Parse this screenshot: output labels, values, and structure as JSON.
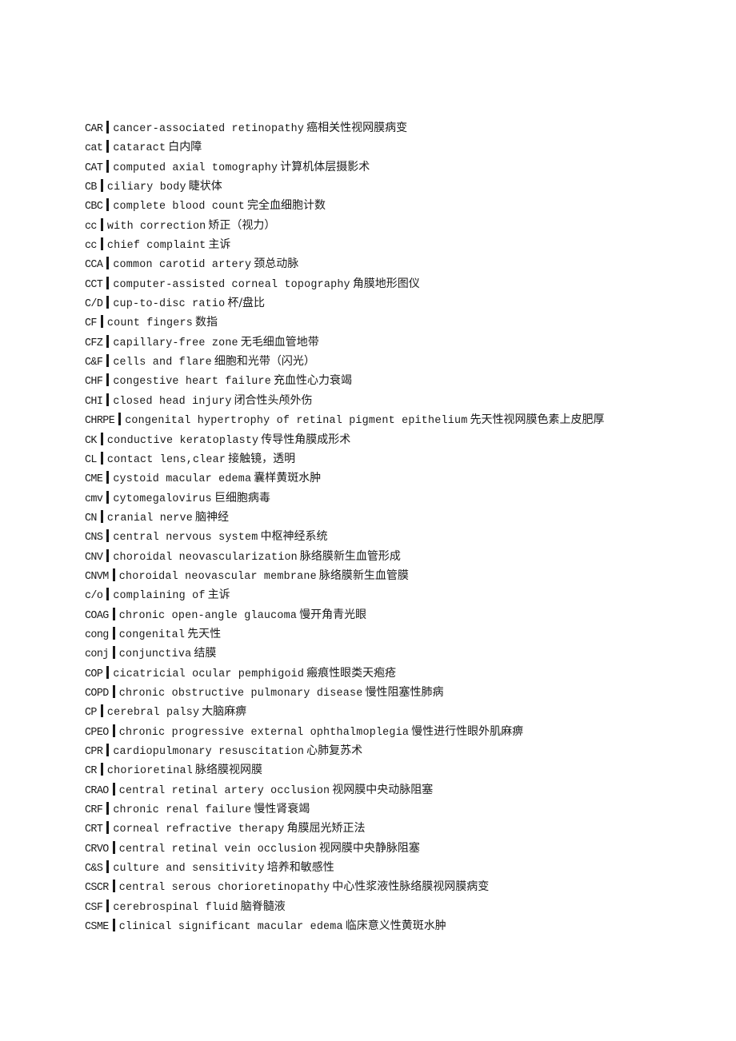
{
  "document": {
    "entries": [
      {
        "abbr": "CAR",
        "term": "cancer-associated retinopathy",
        "zh": "癌相关性视网膜病变"
      },
      {
        "abbr": "cat",
        "term": "cataract",
        "zh": "白内障"
      },
      {
        "abbr": "CAT",
        "term": "computed axial tomography",
        "zh": "计算机体层摄影术"
      },
      {
        "abbr": "CB",
        "term": "ciliary body",
        "zh": "睫状体"
      },
      {
        "abbr": "CBC",
        "term": "complete blood count",
        "zh": "完全血细胞计数"
      },
      {
        "abbr": "cc",
        "term": "with correction",
        "zh": "矫正（视力）"
      },
      {
        "abbr": "cc",
        "term": "chief complaint",
        "zh": "主诉"
      },
      {
        "abbr": "CCA",
        "term": "common carotid artery",
        "zh": "颈总动脉"
      },
      {
        "abbr": "CCT",
        "term": "computer-assisted corneal topography",
        "zh": "角膜地形图仪"
      },
      {
        "abbr": "C/D",
        "term": "cup-to-disc ratio",
        "zh": "杯/盘比"
      },
      {
        "abbr": "CF",
        "term": "count fingers",
        "zh": "数指"
      },
      {
        "abbr": "CFZ",
        "term": "capillary-free zone",
        "zh": "无毛细血管地带"
      },
      {
        "abbr": "C&F",
        "term": "cells and flare",
        "zh": "细胞和光带（闪光）"
      },
      {
        "abbr": "CHF",
        "term": "congestive heart failure",
        "zh": "充血性心力衰竭"
      },
      {
        "abbr": "CHI",
        "term": "closed head injury",
        "zh": "闭合性头颅外伤"
      },
      {
        "abbr": "CHRPE",
        "term": "congenital hypertrophy of retinal pigment epithelium",
        "zh": "先天性视网膜色素上皮肥厚"
      },
      {
        "abbr": "CK",
        "term": "conductive keratoplasty",
        "zh": "传导性角膜成形术"
      },
      {
        "abbr": "CL",
        "term": "contact lens,clear",
        "zh": "接触镜，透明"
      },
      {
        "abbr": "CME",
        "term": "cystoid macular edema",
        "zh": "囊样黄斑水肿"
      },
      {
        "abbr": "cmv",
        "term": "cytomegalovirus",
        "zh": "巨细胞病毒"
      },
      {
        "abbr": "CN",
        "term": "cranial nerve",
        "zh": "脑神经"
      },
      {
        "abbr": "CNS",
        "term": "central nervous system",
        "zh": "中枢神经系统"
      },
      {
        "abbr": "CNV",
        "term": "choroidal neovascularization",
        "zh": "脉络膜新生血管形成"
      },
      {
        "abbr": "CNVM",
        "term": "choroidal neovascular membrane",
        "zh": "脉络膜新生血管膜"
      },
      {
        "abbr": "c/o",
        "term": "complaining of",
        "zh": "主诉"
      },
      {
        "abbr": "COAG",
        "term": "chronic open-angle glaucoma",
        "zh": "慢开角青光眼"
      },
      {
        "abbr": "cong",
        "term": "congenital",
        "zh": "先天性"
      },
      {
        "abbr": "conj",
        "term": "conjunctiva",
        "zh": "结膜"
      },
      {
        "abbr": "COP",
        "term": "cicatricial ocular pemphigoid",
        "zh": "瘢痕性眼类天疱疮"
      },
      {
        "abbr": "COPD",
        "term": "chronic obstructive pulmonary disease",
        "zh": "慢性阻塞性肺病"
      },
      {
        "abbr": "CP",
        "term": "cerebral palsy",
        "zh": "大脑麻痹"
      },
      {
        "abbr": "CPEO",
        "term": "chronic progressive external ophthalmoplegia",
        "zh": "慢性进行性眼外肌麻痹"
      },
      {
        "abbr": "CPR",
        "term": "cardiopulmonary resuscitation",
        "zh": "心肺复苏术"
      },
      {
        "abbr": "CR",
        "term": "chorioretinal",
        "zh": "脉络膜视网膜"
      },
      {
        "abbr": "CRAO",
        "term": "central retinal artery occlusion",
        "zh": "视网膜中央动脉阻塞"
      },
      {
        "abbr": "CRF",
        "term": "chronic renal failure",
        "zh": "慢性肾衰竭"
      },
      {
        "abbr": "CRT",
        "term": "corneal refractive therapy",
        "zh": "角膜屈光矫正法"
      },
      {
        "abbr": "CRVO",
        "term": "central retinal vein occlusion",
        "zh": "视网膜中央静脉阻塞"
      },
      {
        "abbr": "C&S",
        "term": "culture and sensitivity",
        "zh": "培养和敏感性"
      },
      {
        "abbr": "CSCR",
        "term": "central serous chorioretinopathy",
        "zh": "中心性浆液性脉络膜视网膜病变"
      },
      {
        "abbr": "CSF",
        "term": "cerebrospinal fluid",
        "zh": "脑脊髓液"
      },
      {
        "abbr": "CSME",
        "term": "clinical significant macular edema",
        "zh": "临床意义性黄斑水肿"
      }
    ]
  }
}
